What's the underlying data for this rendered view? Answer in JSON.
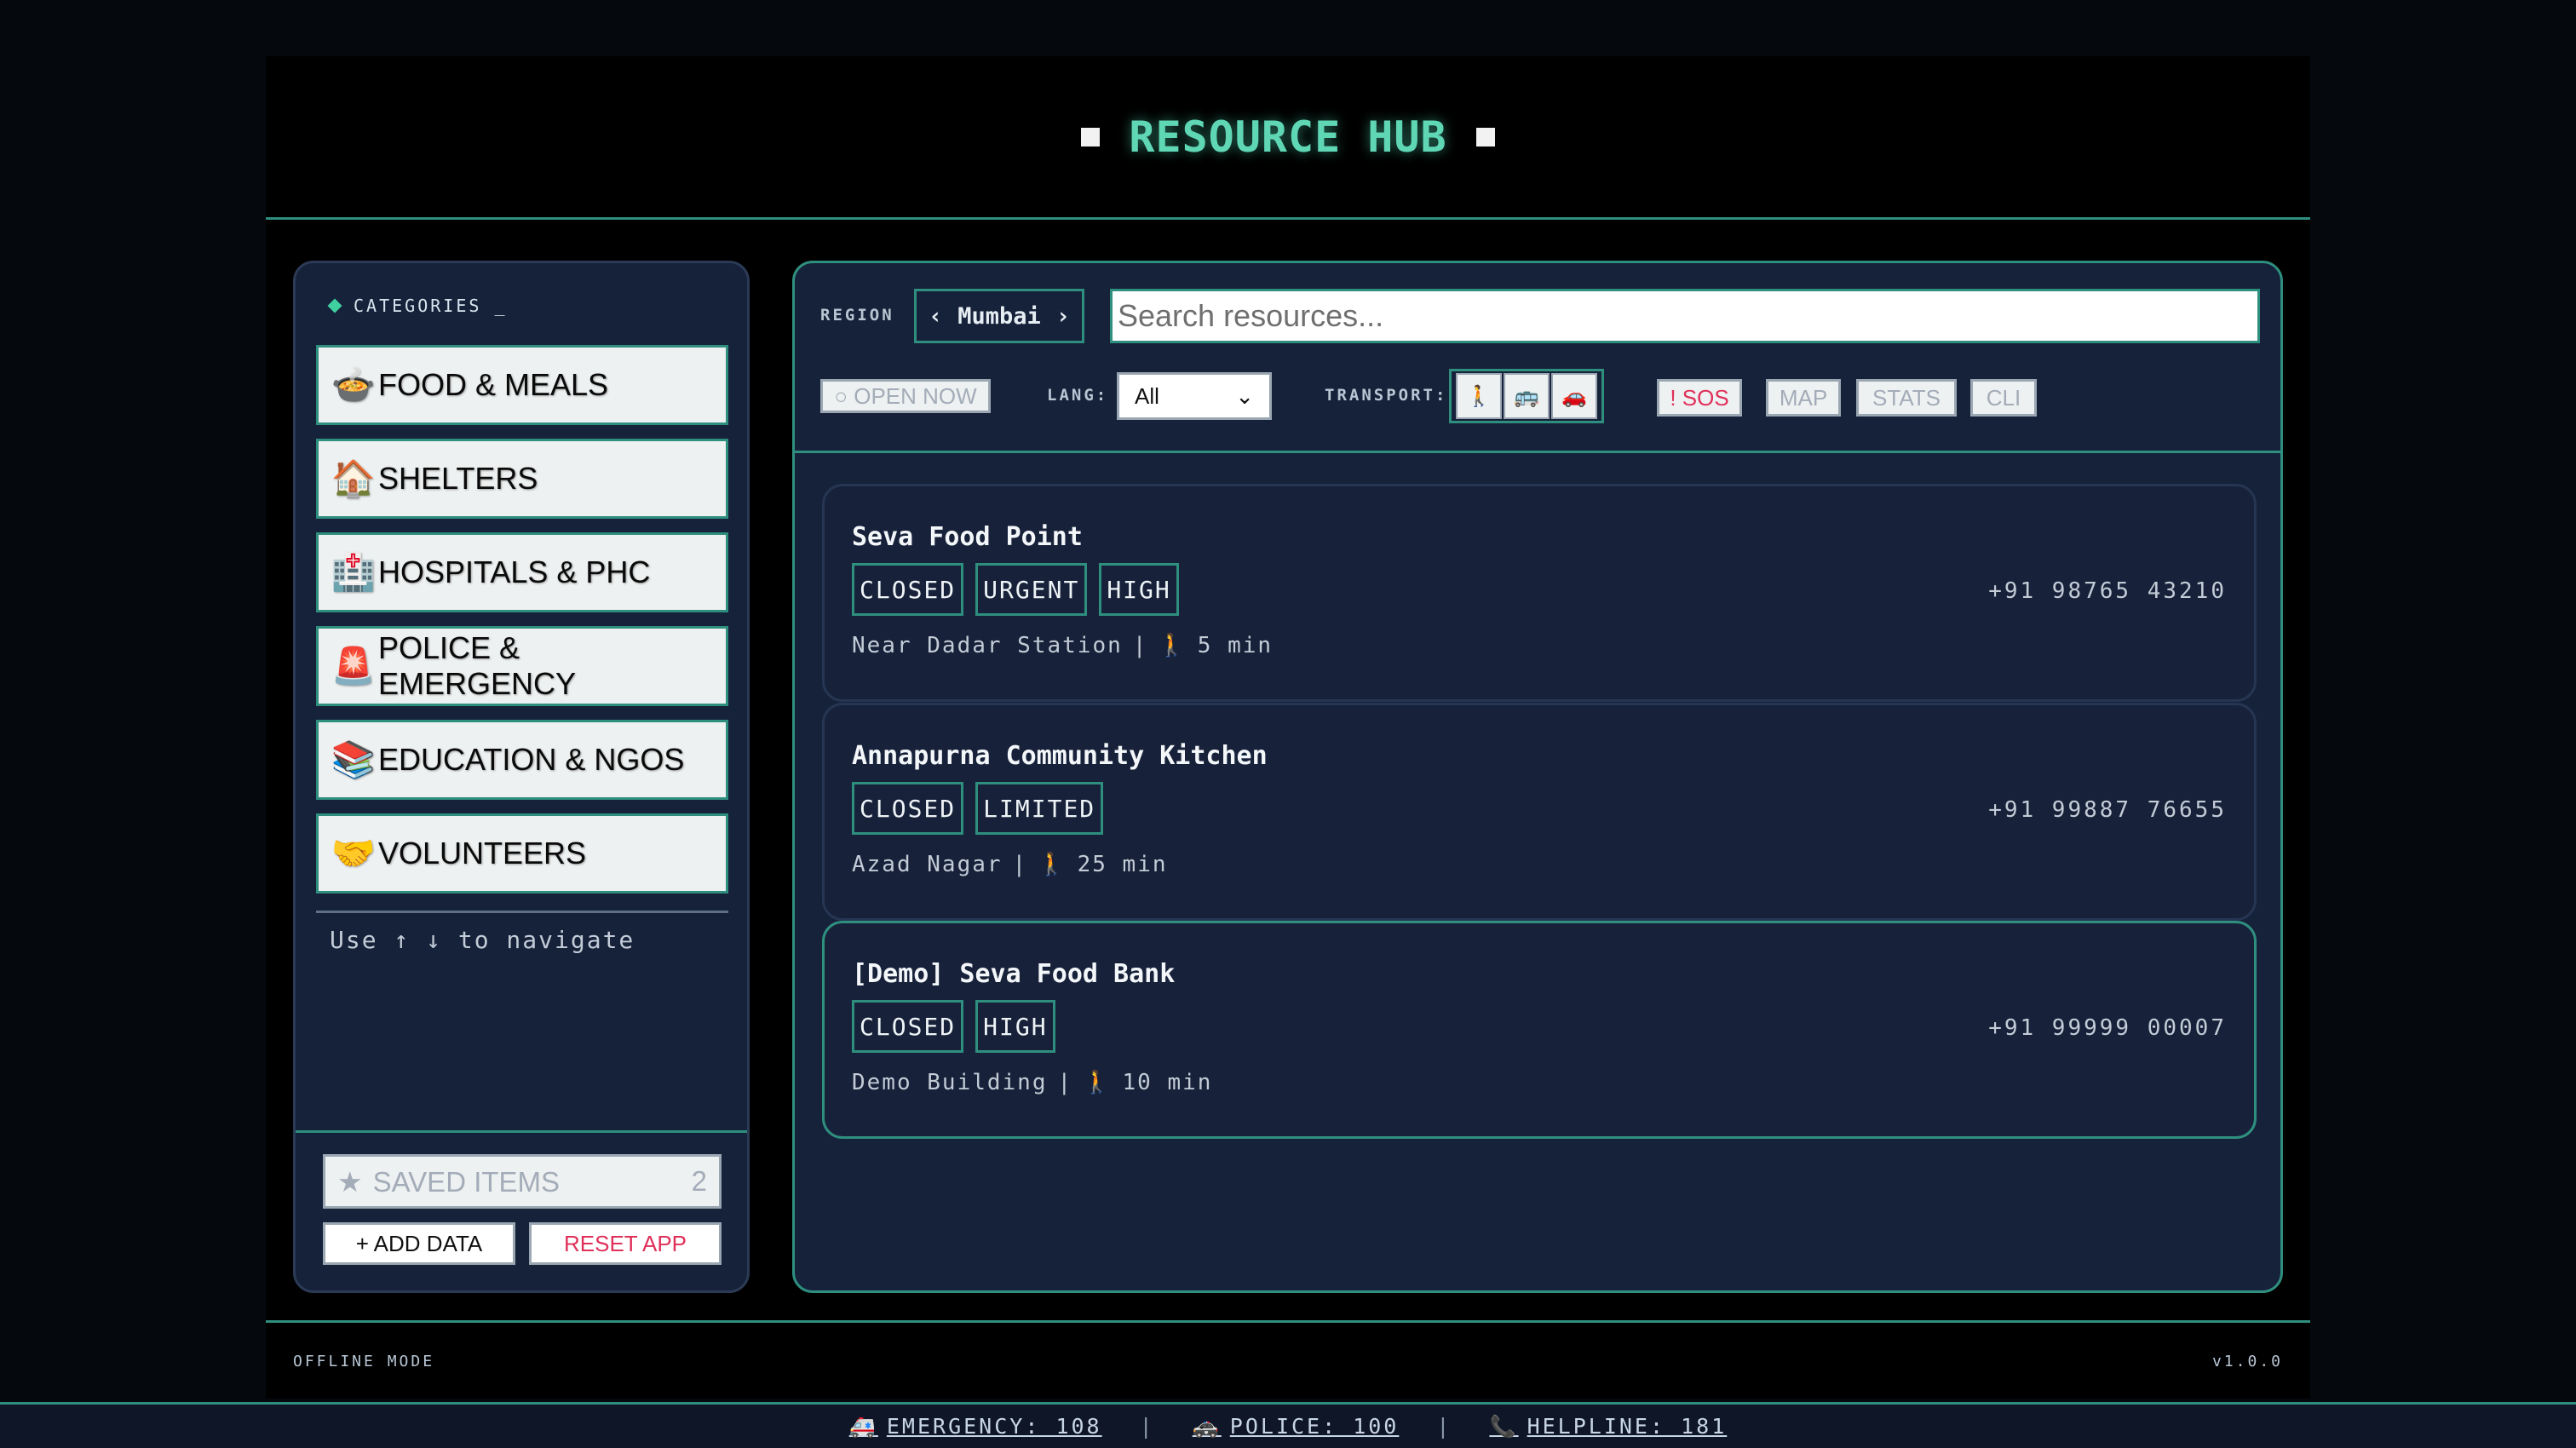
{
  "header": {
    "title": "RESOURCE HUB"
  },
  "sidebar": {
    "heading": "CATEGORIES _",
    "categories": [
      {
        "icon": "🍲",
        "label": "FOOD & MEALS"
      },
      {
        "icon": "🏠",
        "label": "SHELTERS"
      },
      {
        "icon": "🏥",
        "label": "HOSPITALS & PHC"
      },
      {
        "icon": "🚨",
        "label": "POLICE & EMERGENCY"
      },
      {
        "icon": "📚",
        "label": "EDUCATION & NGOS"
      },
      {
        "icon": "🤝",
        "label": "VOLUNTEERS"
      }
    ],
    "nav_hint": "Use ↑ ↓ to navigate",
    "saved_label": "SAVED ITEMS",
    "saved_star": "★",
    "saved_count": "2",
    "add_data": "+ ADD DATA",
    "reset_app": "RESET APP"
  },
  "toolbar": {
    "region_label": "REGION",
    "region_prev": "‹",
    "region_value": "Mumbai",
    "region_next": "›",
    "search_placeholder": "Search resources...",
    "open_now": "○ OPEN NOW",
    "lang_label": "LANG:",
    "lang_value": "All",
    "lang_chevron": "⌄",
    "transport_label": "TRANSPORT:",
    "transport_icons": [
      "🚶",
      "🚌",
      "🚗"
    ],
    "sos": "! SOS",
    "map": "MAP",
    "stats": "STATS",
    "cli": "CLI"
  },
  "results": [
    {
      "name": "Seva Food Point",
      "badges": [
        "CLOSED",
        "URGENT",
        "HIGH"
      ],
      "location": "Near Dadar Station",
      "sep": "|",
      "walk_icon": "🚶",
      "time": "5 min",
      "phone": "+91 98765 43210"
    },
    {
      "name": "Annapurna Community Kitchen",
      "badges": [
        "CLOSED",
        "LIMITED"
      ],
      "location": "Azad Nagar",
      "sep": "|",
      "walk_icon": "🚶",
      "time": "25 min",
      "phone": "+91 99887 76655"
    },
    {
      "name": "[Demo] Seva Food Bank",
      "badges": [
        "CLOSED",
        "HIGH"
      ],
      "location": "Demo Building",
      "sep": "|",
      "walk_icon": "🚶",
      "time": "10 min",
      "phone": "+91 99999 00007"
    }
  ],
  "footer": {
    "left": "OFFLINE MODE",
    "right": "v1.0.0"
  },
  "bottom_bar": {
    "emergency_icon": "🚑",
    "emergency": "EMERGENCY: 108",
    "police_icon": "🚓",
    "police": "POLICE: 100",
    "helpline_icon": "📞",
    "helpline": "HELPLINE: 181",
    "sep": "|"
  },
  "colors": {
    "accent": "#2f8f7f",
    "title": "#5fd6b4",
    "sos": "#e0305a",
    "panel": "#16213a"
  }
}
